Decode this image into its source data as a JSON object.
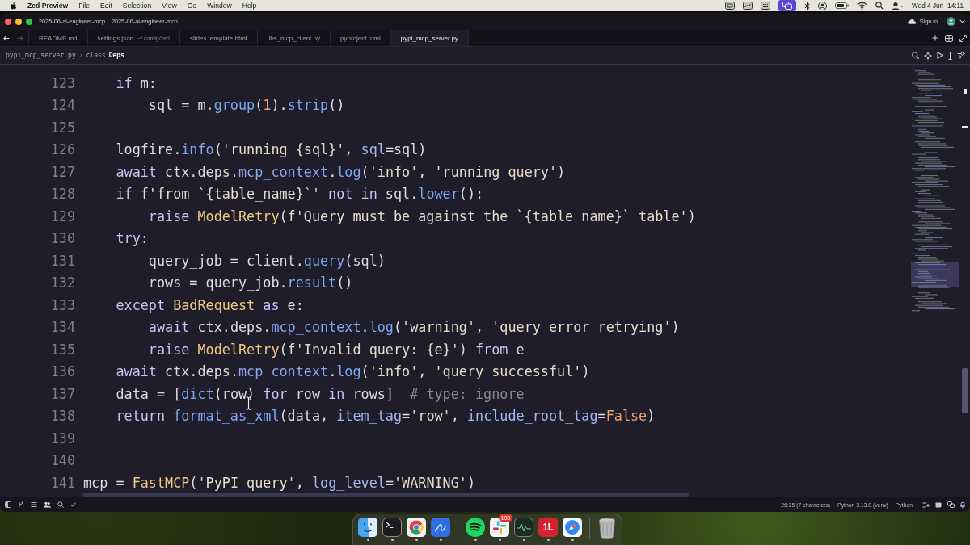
{
  "menu_bar": {
    "app_name": "Zed Preview",
    "menus": [
      "File",
      "Edit",
      "Selection",
      "View",
      "Go",
      "Window",
      "Help"
    ],
    "tray": [
      {
        "kind": "mirror",
        "highlighted": false
      },
      {
        "kind": "graph",
        "highlighted": false
      },
      {
        "kind": "keyboard",
        "highlighted": false
      },
      {
        "kind": "windows",
        "highlighted": true
      },
      {
        "kind": "bluetooth",
        "highlighted": false
      },
      {
        "kind": "account",
        "highlighted": false
      },
      {
        "kind": "battery",
        "highlighted": false
      },
      {
        "kind": "wifi",
        "highlighted": false
      },
      {
        "kind": "search",
        "highlighted": false
      },
      {
        "kind": "controls",
        "highlighted": false
      }
    ],
    "date": "Wed 4 Jun",
    "time": "14:11"
  },
  "title_bar": {
    "title_items": [
      "2025-06-ai-engineer-mcp",
      "2025-06-ai-engineer-mcp"
    ],
    "sign_in": "Sign in"
  },
  "tab_bar": {
    "nav": [
      {
        "kind": "back",
        "disabled": false
      },
      {
        "kind": "forward",
        "disabled": true
      }
    ],
    "tabs": [
      {
        "label": "README.md",
        "selected": false
      },
      {
        "label": "settings.json",
        "detail": "~/.config/zed",
        "selected": false
      },
      {
        "label": "slides.template.html",
        "selected": false
      },
      {
        "label": "libs_mcp_client.py",
        "selected": false
      },
      {
        "label": "pyproject.toml",
        "selected": false
      },
      {
        "label": "pypi_mcp_server.py",
        "selected": true
      }
    ]
  },
  "breadcrumb": {
    "file": "pypi_mcp_server.py",
    "separator": "›",
    "symbol_kind": "class",
    "symbol": "Deps"
  },
  "editor": {
    "lines": [
      {
        "number": "123",
        "code": [
          {
            "text": "    if",
            "kind": "kw"
          },
          {
            "text": " m:",
            "kind": "tx"
          }
        ]
      },
      {
        "number": "124",
        "code": [
          {
            "text": "        sql = m.",
            "kind": "tx"
          },
          {
            "text": "group",
            "kind": "fn"
          },
          {
            "text": "(",
            "kind": "tx"
          },
          {
            "text": "1",
            "kind": "nu"
          },
          {
            "text": ").",
            "kind": "tx"
          },
          {
            "text": "strip",
            "kind": "fn"
          },
          {
            "text": "()",
            "kind": "tx"
          }
        ]
      },
      {
        "number": "125"
      },
      {
        "number": "126",
        "code": [
          {
            "text": "    logfire.",
            "kind": "tx"
          },
          {
            "text": "info",
            "kind": "fn"
          },
          {
            "text": "(",
            "kind": "tx"
          },
          {
            "text": "'running {sql}'",
            "kind": "st"
          },
          {
            "text": ", ",
            "kind": "tx"
          },
          {
            "text": "sql",
            "kind": "pa"
          },
          {
            "text": "=sql)",
            "kind": "tx"
          }
        ]
      },
      {
        "number": "127",
        "code": [
          {
            "text": "    await",
            "kind": "kw"
          },
          {
            "text": " ctx.deps.",
            "kind": "tx"
          },
          {
            "text": "mcp_context",
            "kind": "pr"
          },
          {
            "text": ".",
            "kind": "tx"
          },
          {
            "text": "log",
            "kind": "fn"
          },
          {
            "text": "(",
            "kind": "tx"
          },
          {
            "text": "'info'",
            "kind": "st"
          },
          {
            "text": ", ",
            "kind": "tx"
          },
          {
            "text": "'running query'",
            "kind": "st"
          },
          {
            "text": ")",
            "kind": "tx"
          }
        ]
      },
      {
        "number": "128",
        "code": [
          {
            "text": "    if",
            "kind": "kw"
          },
          {
            "text": " f'from `{table_name}`'",
            "kind": "st"
          },
          {
            "text": " not in",
            "kind": "kw"
          },
          {
            "text": " sql.",
            "kind": "tx"
          },
          {
            "text": "lower",
            "kind": "fn"
          },
          {
            "text": "():",
            "kind": "tx"
          }
        ]
      },
      {
        "number": "129",
        "code": [
          {
            "text": "        raise",
            "kind": "kw"
          },
          {
            "text": " ModelRetry",
            "kind": "cl"
          },
          {
            "text": "(",
            "kind": "tx"
          },
          {
            "text": "f'Query must be against the `{table_name}` table'",
            "kind": "st"
          },
          {
            "text": ")",
            "kind": "tx"
          }
        ]
      },
      {
        "number": "130",
        "code": [
          {
            "text": "    try",
            "kind": "kw"
          },
          {
            "text": ":",
            "kind": "tx"
          }
        ]
      },
      {
        "number": "131",
        "code": [
          {
            "text": "        query_job = client.",
            "kind": "tx"
          },
          {
            "text": "query",
            "kind": "fn"
          },
          {
            "text": "(sql)",
            "kind": "tx"
          }
        ]
      },
      {
        "number": "132",
        "code": [
          {
            "text": "        rows = query_job.",
            "kind": "tx"
          },
          {
            "text": "result",
            "kind": "fn"
          },
          {
            "text": "()",
            "kind": "tx"
          }
        ]
      },
      {
        "number": "133",
        "code": [
          {
            "text": "    except",
            "kind": "kw"
          },
          {
            "text": " BadRequest",
            "kind": "cl"
          },
          {
            "text": " as",
            "kind": "kw"
          },
          {
            "text": " e:",
            "kind": "tx"
          }
        ]
      },
      {
        "number": "134",
        "code": [
          {
            "text": "        await",
            "kind": "kw"
          },
          {
            "text": " ctx.deps.",
            "kind": "tx"
          },
          {
            "text": "mcp_context",
            "kind": "pr"
          },
          {
            "text": ".",
            "kind": "tx"
          },
          {
            "text": "log",
            "kind": "fn"
          },
          {
            "text": "(",
            "kind": "tx"
          },
          {
            "text": "'warning'",
            "kind": "st"
          },
          {
            "text": ", ",
            "kind": "tx"
          },
          {
            "text": "'query error retrying'",
            "kind": "st"
          },
          {
            "text": ")",
            "kind": "tx"
          }
        ]
      },
      {
        "number": "135",
        "code": [
          {
            "text": "        raise",
            "kind": "kw"
          },
          {
            "text": " ModelRetry",
            "kind": "cl"
          },
          {
            "text": "(",
            "kind": "tx"
          },
          {
            "text": "f'Invalid query: {e}'",
            "kind": "st"
          },
          {
            "text": ")",
            "kind": "tx"
          },
          {
            "text": " from",
            "kind": "kw"
          },
          {
            "text": " e",
            "kind": "tx"
          }
        ]
      },
      {
        "number": "136",
        "code": [
          {
            "text": "    await",
            "kind": "kw"
          },
          {
            "text": " ctx.deps.",
            "kind": "tx"
          },
          {
            "text": "mcp_context",
            "kind": "pr"
          },
          {
            "text": ".",
            "kind": "tx"
          },
          {
            "text": "log",
            "kind": "fn"
          },
          {
            "text": "(",
            "kind": "tx"
          },
          {
            "text": "'info'",
            "kind": "st"
          },
          {
            "text": ", ",
            "kind": "tx"
          },
          {
            "text": "'query successful'",
            "kind": "st"
          },
          {
            "text": ")",
            "kind": "tx"
          }
        ]
      },
      {
        "number": "137",
        "code": [
          {
            "text": "    data = [",
            "kind": "tx"
          },
          {
            "text": "dict",
            "kind": "fn"
          },
          {
            "text": "(row)",
            "kind": "tx"
          },
          {
            "text": " for",
            "kind": "kw"
          },
          {
            "text": " row",
            "kind": "tx"
          },
          {
            "text": " in",
            "kind": "kw"
          },
          {
            "text": " rows]  ",
            "kind": "tx"
          },
          {
            "text": "# type: ignore",
            "kind": "cm"
          }
        ]
      },
      {
        "number": "138",
        "code": [
          {
            "text": "    return",
            "kind": "kw"
          },
          {
            "text": " format_as_xml",
            "kind": "fn"
          },
          {
            "text": "(data, ",
            "kind": "tx"
          },
          {
            "text": "item_tag",
            "kind": "pa"
          },
          {
            "text": "=",
            "kind": "tx"
          },
          {
            "text": "'row'",
            "kind": "st"
          },
          {
            "text": ", ",
            "kind": "tx"
          },
          {
            "text": "include_root_tag",
            "kind": "pa"
          },
          {
            "text": "=",
            "kind": "tx"
          },
          {
            "text": "False",
            "kind": "nu"
          },
          {
            "text": ")",
            "kind": "tx"
          }
        ]
      },
      {
        "number": "139"
      },
      {
        "number": "140"
      },
      {
        "number": "141",
        "code": [
          {
            "text": "mcp = ",
            "kind": "tx"
          },
          {
            "text": "FastMCP",
            "kind": "cl"
          },
          {
            "text": "(",
            "kind": "tx"
          },
          {
            "text": "'PyPI query'",
            "kind": "st"
          },
          {
            "text": ", ",
            "kind": "tx"
          },
          {
            "text": "log_level",
            "kind": "pa"
          },
          {
            "text": "=",
            "kind": "tx"
          },
          {
            "text": "'WARNING'",
            "kind": "st"
          },
          {
            "text": ")",
            "kind": "tx"
          }
        ]
      }
    ]
  },
  "status_bar": {
    "cursor_position": "26:25 (7 characters)",
    "interpreter": "Python 3.13.0 (venv)",
    "language": "Python"
  },
  "dock": {
    "items": [
      {
        "kind": "face",
        "running": true
      },
      {
        "kind": "terminal",
        "running": true
      },
      {
        "kind": "ring",
        "running": true
      },
      {
        "kind": "pen",
        "running": true
      },
      {
        "kind": "divider"
      },
      {
        "kind": "waves",
        "running": true
      },
      {
        "kind": "pinwheel",
        "running": true,
        "badge": "108"
      },
      {
        "kind": "graph",
        "running": true
      },
      {
        "kind": "letters",
        "running": true,
        "label": "1L"
      },
      {
        "kind": "compass",
        "running": true
      },
      {
        "kind": "divider"
      },
      {
        "kind": "trash",
        "running": false
      }
    ]
  }
}
